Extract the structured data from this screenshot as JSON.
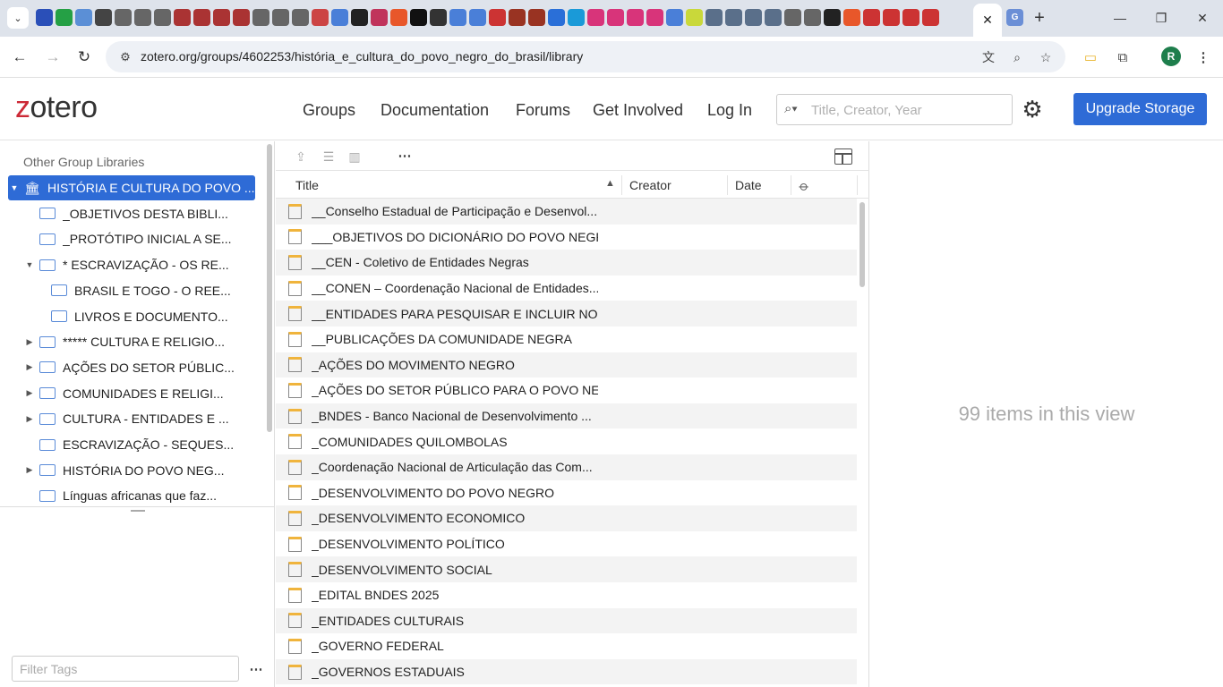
{
  "browser": {
    "url": "zotero.org/groups/4602253/história_e_cultura_do_povo_negro_do_brasil/library",
    "profile_initial": "R",
    "tab_close_label": "✕"
  },
  "header": {
    "logo": "zotero",
    "nav": [
      "Groups",
      "Documentation",
      "Forums",
      "Get Involved",
      "Log In"
    ],
    "search_placeholder": "Title, Creator, Year",
    "upgrade_label": "Upgrade Storage"
  },
  "library": {
    "heading": "Other Group Libraries",
    "collections": [
      {
        "label": "HISTÓRIA E CULTURA DO POVO ...",
        "twisty": "▼",
        "level": 0,
        "type": "library",
        "selected": true
      },
      {
        "label": "_OBJETIVOS DESTA BIBLI...",
        "twisty": "",
        "level": 1,
        "type": "folder"
      },
      {
        "label": "_PROTÓTIPO INICIAL A SE...",
        "twisty": "",
        "level": 1,
        "type": "folder"
      },
      {
        "label": "* ESCRAVIZAÇÃO - OS RE...",
        "twisty": "▼",
        "level": 1,
        "type": "folder"
      },
      {
        "label": "BRASIL E TOGO - O REE...",
        "twisty": "",
        "level": 2,
        "type": "folder"
      },
      {
        "label": "LIVROS E DOCUMENTO...",
        "twisty": "",
        "level": 2,
        "type": "folder"
      },
      {
        "label": "***** CULTURA E RELIGIO...",
        "twisty": "▶",
        "level": 1,
        "type": "folder"
      },
      {
        "label": "AÇÕES DO SETOR PÚBLIC...",
        "twisty": "▶",
        "level": 1,
        "type": "folder"
      },
      {
        "label": "COMUNIDADES E RELIGI...",
        "twisty": "▶",
        "level": 1,
        "type": "folder"
      },
      {
        "label": "CULTURA - ENTIDADES E ...",
        "twisty": "▶",
        "level": 1,
        "type": "folder"
      },
      {
        "label": "ESCRAVIZAÇÃO - SEQUES...",
        "twisty": "",
        "level": 1,
        "type": "folder"
      },
      {
        "label": "HISTÓRIA DO POVO NEG...",
        "twisty": "▶",
        "level": 1,
        "type": "folder"
      },
      {
        "label": "Línguas africanas que faz...",
        "twisty": "",
        "level": 1,
        "type": "folder"
      }
    ],
    "tag_filter_placeholder": "Filter Tags"
  },
  "items": {
    "columns": {
      "title": "Title",
      "creator": "Creator",
      "date": "Date"
    },
    "rows": [
      "__Conselho Estadual de Participação e Desenvol...",
      "___OBJETIVOS DO DICIONÁRIO DO POVO NEGRO",
      "__CEN - Coletivo de Entidades Negras",
      "__CONEN – Coordenação Nacional de Entidades...",
      "__ENTIDADES PARA PESQUISAR E INCLUIR NO ...",
      "__PUBLICAÇÕES DA COMUNIDADE NEGRA",
      "_AÇÕES DO MOVIMENTO NEGRO",
      "_AÇÕES DO SETOR PÚBLICO PARA O POVO NEG...",
      "_BNDES - Banco Nacional de Desenvolvimento ...",
      "_COMUNIDADES QUILOMBOLAS",
      "_Coordenação Nacional de Articulação das Com...",
      "_DESENVOLVIMENTO DO POVO NEGRO",
      "_DESENVOLVIMENTO ECONOMICO",
      "_DESENVOLVIMENTO POLÍTICO",
      "_DESENVOLVIMENTO SOCIAL",
      "_EDITAL BNDES 2025",
      "_ENTIDADES CULTURAIS",
      "_GOVERNO FEDERAL",
      "_GOVERNOS ESTADUAIS"
    ]
  },
  "detail": {
    "count_text": "99 items in this view"
  },
  "colors": {
    "accent": "#2e6bd6",
    "logo_z": "#cc2936",
    "note_icon_top": "#f0b43c"
  }
}
